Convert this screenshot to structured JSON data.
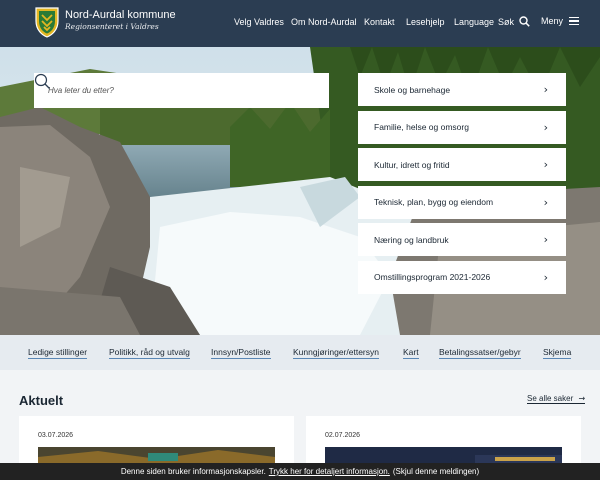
{
  "brand": {
    "name": "Nord-Aurdal kommune",
    "tagline": "Regionsenteret i Valdres",
    "colors": {
      "header": "#2b3d52",
      "shield": "#2b7a36",
      "gold": "#e3b622"
    }
  },
  "topnav": {
    "items": [
      "Velg Valdres",
      "Om Nord-Aurdal",
      "Kontakt",
      "Lesehjelp",
      "Language"
    ],
    "search_label": "Søk",
    "menu_label": "Meny"
  },
  "search": {
    "placeholder": "Hva leter du etter?"
  },
  "categories": [
    "Skole og barnehage",
    "Familie, helse og omsorg",
    "Kultur, idrett og fritid",
    "Teknisk, plan, bygg og eiendom",
    "Næring og landbruk",
    "Omstillingsprogram 2021-2026"
  ],
  "quick_links": [
    "Ledige stillinger",
    "Politikk, råd og utvalg",
    "Innsyn/Postliste",
    "Kunngjøringer/ettersyn",
    "Kart",
    "Betalingssatser/gebyr",
    "Skjema"
  ],
  "news": {
    "title": "Aktuelt",
    "see_all": "Se alle saker",
    "cards": [
      {
        "date": "03.07.2026"
      },
      {
        "date": "02.07.2026"
      }
    ]
  },
  "cookie": {
    "text_before": "Denne siden bruker informasjonskapsler.",
    "link": "Trykk her for detaljert informasjon.",
    "dismiss": "(Skjul denne meldingen)"
  }
}
